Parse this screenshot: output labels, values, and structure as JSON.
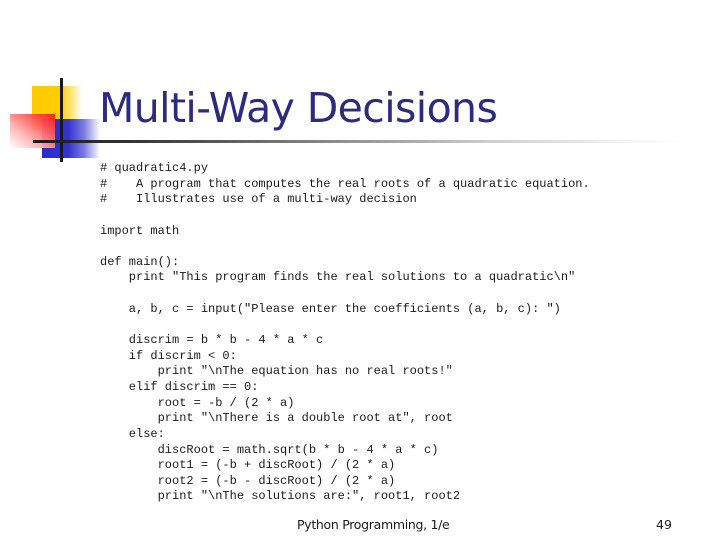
{
  "slide": {
    "title": "Multi-Way Decisions",
    "title_color": "#2b2b80",
    "code_lines": [
      "# quadratic4.py",
      "#    A program that computes the real roots of a quadratic equation.",
      "#    Illustrates use of a multi-way decision",
      "",
      "import math",
      "",
      "def main():",
      "    print \"This program finds the real solutions to a quadratic\\n\"",
      "",
      "    a, b, c = input(\"Please enter the coefficients (a, b, c): \")",
      "",
      "    discrim = b * b - 4 * a * c",
      "    if discrim < 0:",
      "        print \"\\nThe equation has no real roots!\"",
      "    elif discrim == 0:",
      "        root = -b / (2 * a)",
      "        print \"\\nThere is a double root at\", root",
      "    else:",
      "        discRoot = math.sqrt(b * b - 4 * a * c)",
      "        root1 = (-b + discRoot) / (2 * a)",
      "        root2 = (-b - discRoot) / (2 * a)",
      "        print \"\\nThe solutions are:\", root1, root2"
    ],
    "footer": "Python Programming, 1/e",
    "page_number": "49"
  },
  "logo": {
    "colors": {
      "yellow": "#ffcc00",
      "blue": "#3333cc",
      "red": "#ff1a1a",
      "line": "#1a1a1a"
    }
  }
}
